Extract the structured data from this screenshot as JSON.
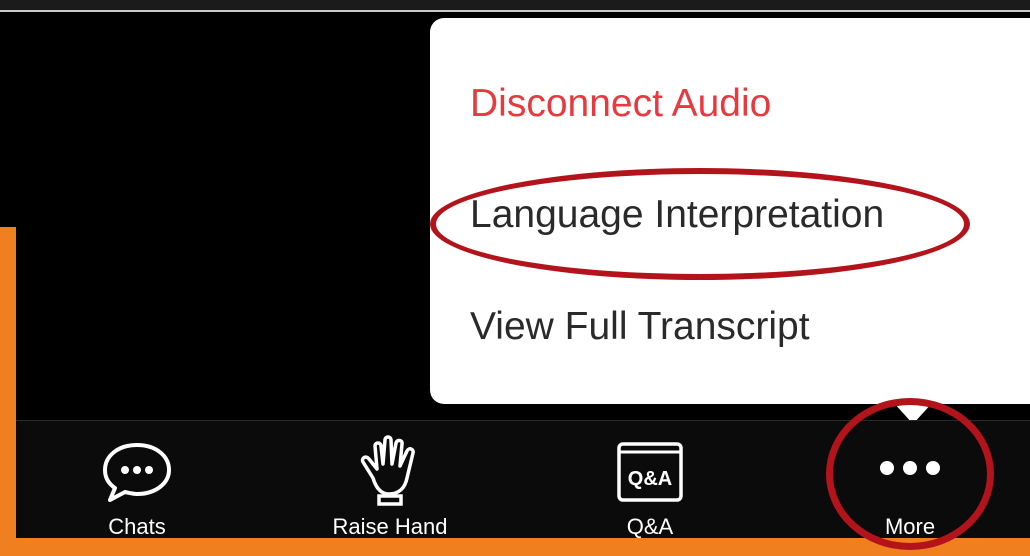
{
  "menu": {
    "items": [
      {
        "label": "Disconnect Audio",
        "color": "#e8393f"
      },
      {
        "label": "Language Interpretation"
      },
      {
        "label": "View Full Transcript"
      }
    ]
  },
  "toolbar": {
    "items": [
      {
        "label": "Chats",
        "icon": "chat-bubble-icon"
      },
      {
        "label": "Raise Hand",
        "icon": "raise-hand-icon"
      },
      {
        "label": "Q&A",
        "icon": "qa-icon",
        "icon_text": "Q&A"
      },
      {
        "label": "More",
        "icon": "more-dots-icon"
      }
    ]
  },
  "annotations": {
    "highlight_color": "#b3141c",
    "highlighted": [
      "Language Interpretation",
      "More"
    ]
  },
  "colors": {
    "background": "#f07f1f",
    "screen": "#000000",
    "menu": "#ffffff",
    "danger": "#e8393f"
  }
}
